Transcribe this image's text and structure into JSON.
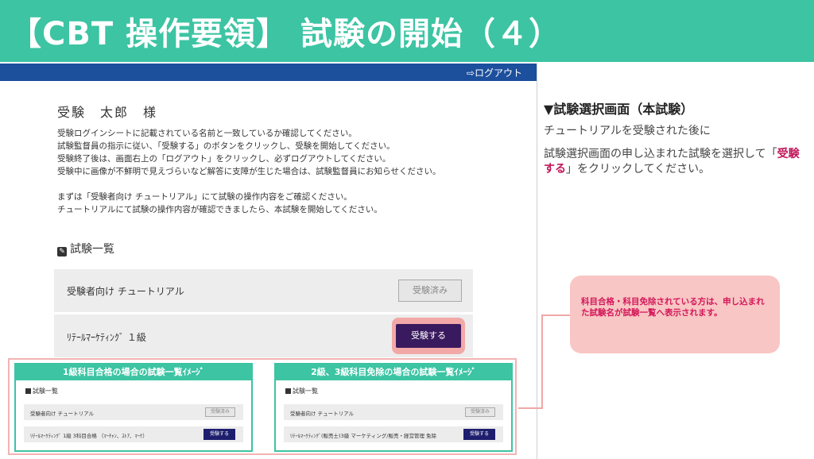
{
  "header": {
    "title": "【CBT 操作要領】 試験の開始（４）"
  },
  "app": {
    "logout_label": "ログアウト",
    "user_name": "受験　太郎　様",
    "instructions": [
      "受験ログインシートに記載されている名前と一致しているか確認してください。",
      "試験監督員の指示に従い、「受験する」のボタンをクリックし、受験を開始してください。",
      "受験終了後は、画面右上の「ログアウト」をクリックし、必ずログアウトしてください。",
      "受験中に画像が不鮮明で見えづらいなど解答に支障が生じた場合は、試験監督員にお知らせください。",
      "まずは「受験者向け チュートリアル」にて試験の操作内容をご確認ください。",
      "チュートリアルにて試験の操作内容が確認できましたら、本試験を開始してください。"
    ],
    "exam_list_title": "試験一覧",
    "exams": [
      {
        "name": "受験者向け チュートリアル",
        "button": "受験済み"
      },
      {
        "name": "ﾘﾃｰﾙﾏｰｹﾃｨﾝｸﾞ １級",
        "button": "受験する"
      }
    ]
  },
  "explanation": {
    "heading": "▼試験選択画面（本試験）",
    "line1": "チュートリアルを受験された後に",
    "line2_pre": "試験選択画面の申し込まれた試験を選択して「",
    "line2_emph": "受験する",
    "line2_post": "」をクリックしてください。"
  },
  "callout": {
    "text": "科目合格・科目免除されている方は、申し込まれた試験名が試験一覧へ表示されます。"
  },
  "examples": [
    {
      "title": "1級科目合格の場合の試験一覧ｲﾒｰｼﾞ",
      "section": "試験一覧",
      "rows": [
        {
          "name": "受験者向け チュートリアル",
          "button": "受験済み"
        },
        {
          "name": "ﾘﾃｰﾙﾏｰｹﾃｨﾝｸﾞ 1級 3科目合格 （ﾏｰﾁｬﾝ、ｽﾄｱ、ﾏｰｹ）",
          "button": "受験する"
        }
      ]
    },
    {
      "title": "2級、3級科目免除の場合の試験一覧ｲﾒｰｼﾞ",
      "section": "試験一覧",
      "rows": [
        {
          "name": "受験者向け チュートリアル",
          "button": "受験済み"
        },
        {
          "name": "ﾘﾃｰﾙﾏｰｹﾃｨﾝｸﾞ(販売士)3級 マーケティング/販売・経営管理 免除",
          "button": "受験する"
        }
      ]
    }
  ],
  "colors": {
    "brand_teal": "#3cc4a3",
    "nav_blue": "#1c4f9c",
    "take_button": "#3a1a5e",
    "emphasis_magenta": "#c1185b",
    "callout_bg": "#f8c6c4"
  }
}
